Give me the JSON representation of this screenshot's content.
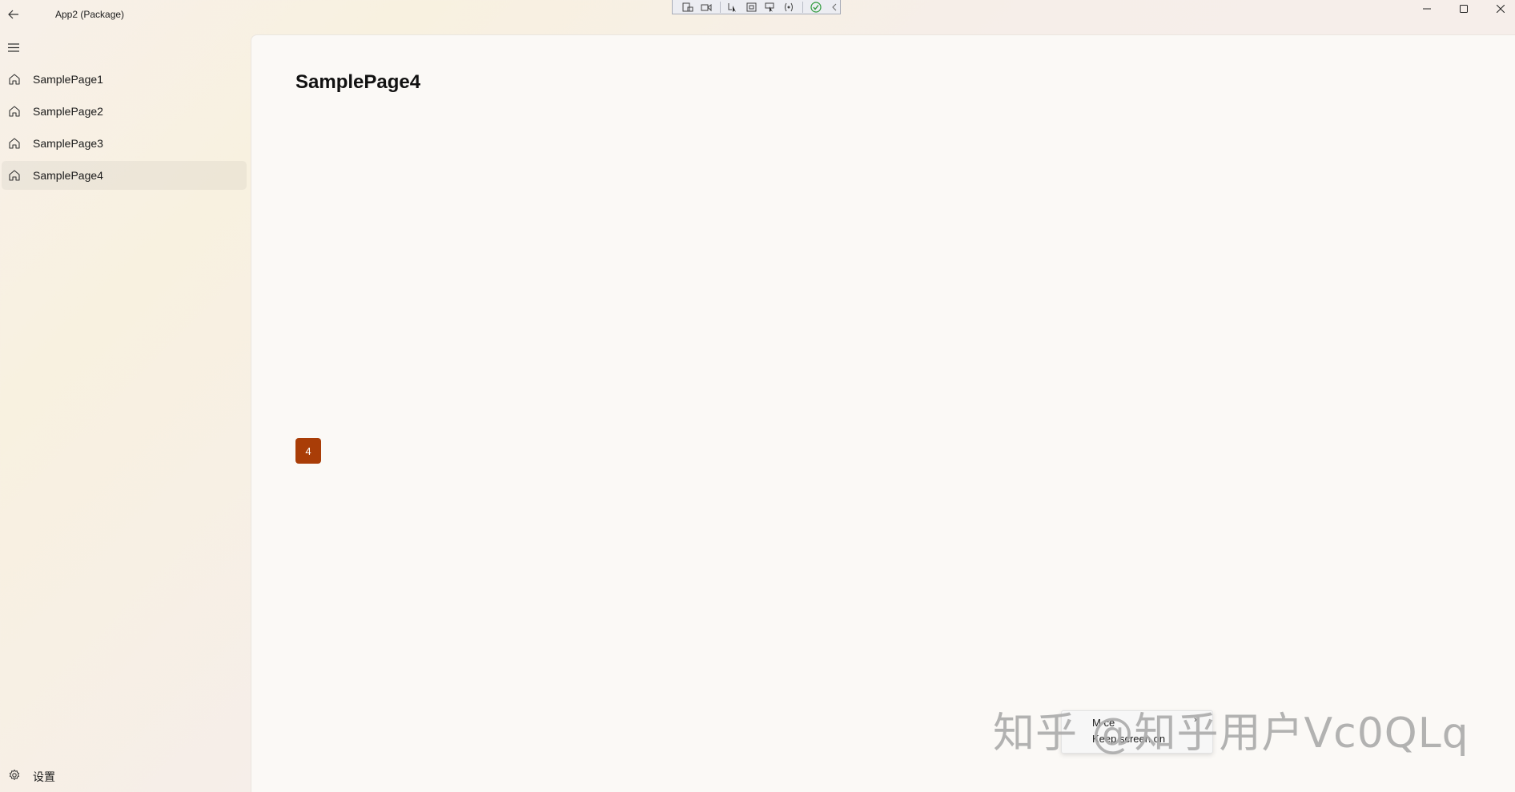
{
  "window": {
    "title": "App2 (Package)",
    "minimize_icon": "minimize-icon",
    "maximize_icon": "maximize-icon",
    "close_icon": "close-icon"
  },
  "debug_toolbar": {
    "icons": [
      "live-visual-tree-icon",
      "record-icon",
      "select-element-icon",
      "display-layout-adorners-icon",
      "track-focus-icon",
      "binding-failures-icon",
      "hot-reload-check-icon",
      "collapse-chevron-icon"
    ]
  },
  "nav": {
    "items": [
      {
        "label": "SamplePage1",
        "icon": "home-icon"
      },
      {
        "label": "SamplePage2",
        "icon": "home-icon"
      },
      {
        "label": "SamplePage3",
        "icon": "home-icon"
      },
      {
        "label": "SamplePage4",
        "icon": "home-icon",
        "selected": true
      }
    ],
    "settings_label": "设置"
  },
  "content": {
    "page_title": "SamplePage4",
    "badge_value": "4",
    "badge_color": "#a93d07"
  },
  "context_menu": {
    "items": [
      "M  ce",
      "Keep screen on"
    ]
  },
  "watermark": "知乎 @知乎用户Vc0QLq"
}
